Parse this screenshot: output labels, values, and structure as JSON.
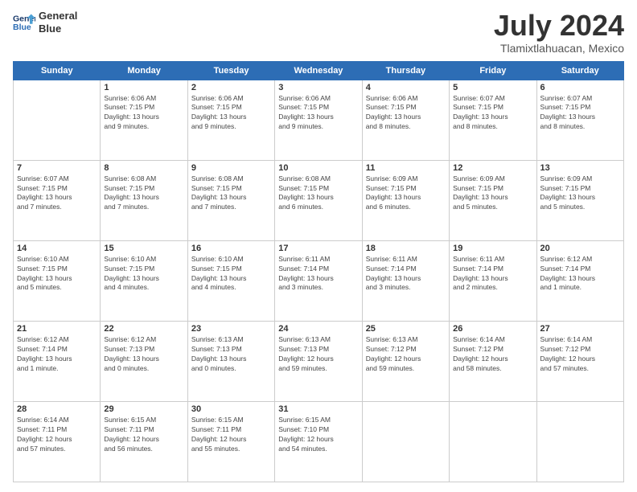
{
  "logo": {
    "line1": "General",
    "line2": "Blue"
  },
  "title": "July 2024",
  "location": "Tlamixtlahuacan, Mexico",
  "days_of_week": [
    "Sunday",
    "Monday",
    "Tuesday",
    "Wednesday",
    "Thursday",
    "Friday",
    "Saturday"
  ],
  "weeks": [
    [
      {
        "day": "",
        "info": ""
      },
      {
        "day": "1",
        "info": "Sunrise: 6:06 AM\nSunset: 7:15 PM\nDaylight: 13 hours\nand 9 minutes."
      },
      {
        "day": "2",
        "info": "Sunrise: 6:06 AM\nSunset: 7:15 PM\nDaylight: 13 hours\nand 9 minutes."
      },
      {
        "day": "3",
        "info": "Sunrise: 6:06 AM\nSunset: 7:15 PM\nDaylight: 13 hours\nand 9 minutes."
      },
      {
        "day": "4",
        "info": "Sunrise: 6:06 AM\nSunset: 7:15 PM\nDaylight: 13 hours\nand 8 minutes."
      },
      {
        "day": "5",
        "info": "Sunrise: 6:07 AM\nSunset: 7:15 PM\nDaylight: 13 hours\nand 8 minutes."
      },
      {
        "day": "6",
        "info": "Sunrise: 6:07 AM\nSunset: 7:15 PM\nDaylight: 13 hours\nand 8 minutes."
      }
    ],
    [
      {
        "day": "7",
        "info": "Sunrise: 6:07 AM\nSunset: 7:15 PM\nDaylight: 13 hours\nand 7 minutes."
      },
      {
        "day": "8",
        "info": "Sunrise: 6:08 AM\nSunset: 7:15 PM\nDaylight: 13 hours\nand 7 minutes."
      },
      {
        "day": "9",
        "info": "Sunrise: 6:08 AM\nSunset: 7:15 PM\nDaylight: 13 hours\nand 7 minutes."
      },
      {
        "day": "10",
        "info": "Sunrise: 6:08 AM\nSunset: 7:15 PM\nDaylight: 13 hours\nand 6 minutes."
      },
      {
        "day": "11",
        "info": "Sunrise: 6:09 AM\nSunset: 7:15 PM\nDaylight: 13 hours\nand 6 minutes."
      },
      {
        "day": "12",
        "info": "Sunrise: 6:09 AM\nSunset: 7:15 PM\nDaylight: 13 hours\nand 5 minutes."
      },
      {
        "day": "13",
        "info": "Sunrise: 6:09 AM\nSunset: 7:15 PM\nDaylight: 13 hours\nand 5 minutes."
      }
    ],
    [
      {
        "day": "14",
        "info": "Sunrise: 6:10 AM\nSunset: 7:15 PM\nDaylight: 13 hours\nand 5 minutes."
      },
      {
        "day": "15",
        "info": "Sunrise: 6:10 AM\nSunset: 7:15 PM\nDaylight: 13 hours\nand 4 minutes."
      },
      {
        "day": "16",
        "info": "Sunrise: 6:10 AM\nSunset: 7:15 PM\nDaylight: 13 hours\nand 4 minutes."
      },
      {
        "day": "17",
        "info": "Sunrise: 6:11 AM\nSunset: 7:14 PM\nDaylight: 13 hours\nand 3 minutes."
      },
      {
        "day": "18",
        "info": "Sunrise: 6:11 AM\nSunset: 7:14 PM\nDaylight: 13 hours\nand 3 minutes."
      },
      {
        "day": "19",
        "info": "Sunrise: 6:11 AM\nSunset: 7:14 PM\nDaylight: 13 hours\nand 2 minutes."
      },
      {
        "day": "20",
        "info": "Sunrise: 6:12 AM\nSunset: 7:14 PM\nDaylight: 13 hours\nand 1 minute."
      }
    ],
    [
      {
        "day": "21",
        "info": "Sunrise: 6:12 AM\nSunset: 7:14 PM\nDaylight: 13 hours\nand 1 minute."
      },
      {
        "day": "22",
        "info": "Sunrise: 6:12 AM\nSunset: 7:13 PM\nDaylight: 13 hours\nand 0 minutes."
      },
      {
        "day": "23",
        "info": "Sunrise: 6:13 AM\nSunset: 7:13 PM\nDaylight: 13 hours\nand 0 minutes."
      },
      {
        "day": "24",
        "info": "Sunrise: 6:13 AM\nSunset: 7:13 PM\nDaylight: 12 hours\nand 59 minutes."
      },
      {
        "day": "25",
        "info": "Sunrise: 6:13 AM\nSunset: 7:12 PM\nDaylight: 12 hours\nand 59 minutes."
      },
      {
        "day": "26",
        "info": "Sunrise: 6:14 AM\nSunset: 7:12 PM\nDaylight: 12 hours\nand 58 minutes."
      },
      {
        "day": "27",
        "info": "Sunrise: 6:14 AM\nSunset: 7:12 PM\nDaylight: 12 hours\nand 57 minutes."
      }
    ],
    [
      {
        "day": "28",
        "info": "Sunrise: 6:14 AM\nSunset: 7:11 PM\nDaylight: 12 hours\nand 57 minutes."
      },
      {
        "day": "29",
        "info": "Sunrise: 6:15 AM\nSunset: 7:11 PM\nDaylight: 12 hours\nand 56 minutes."
      },
      {
        "day": "30",
        "info": "Sunrise: 6:15 AM\nSunset: 7:11 PM\nDaylight: 12 hours\nand 55 minutes."
      },
      {
        "day": "31",
        "info": "Sunrise: 6:15 AM\nSunset: 7:10 PM\nDaylight: 12 hours\nand 54 minutes."
      },
      {
        "day": "",
        "info": ""
      },
      {
        "day": "",
        "info": ""
      },
      {
        "day": "",
        "info": ""
      }
    ]
  ]
}
